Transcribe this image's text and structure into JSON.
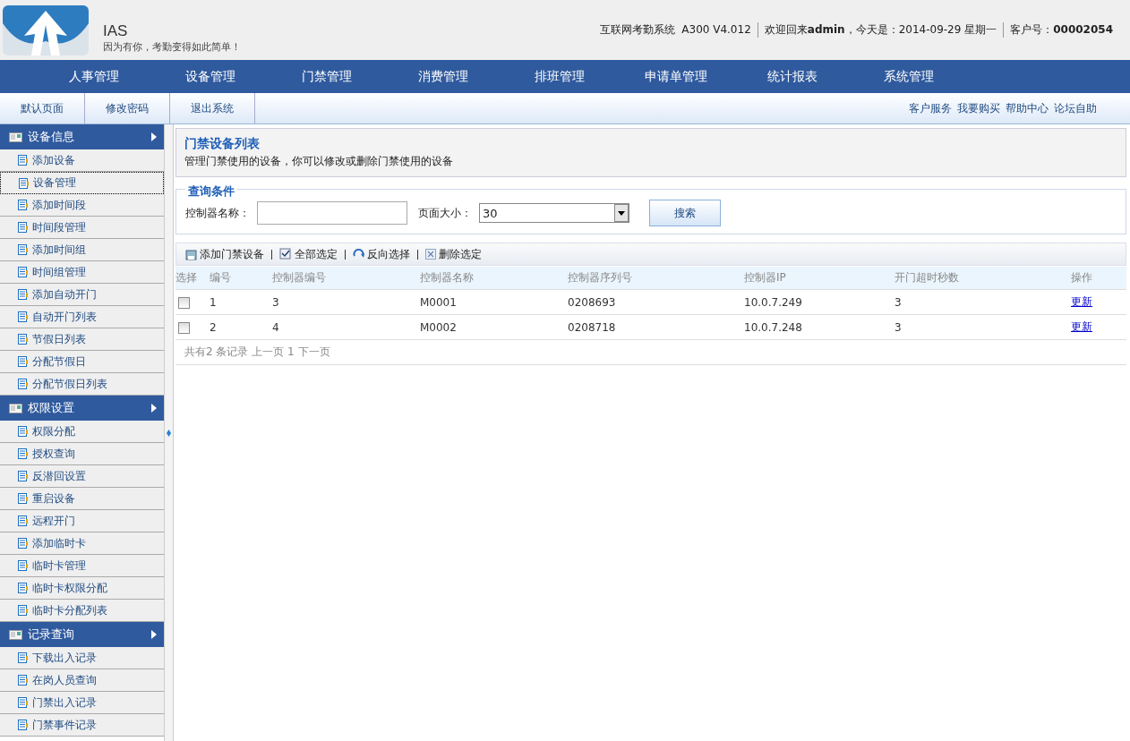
{
  "header": {
    "app_name": "IAS",
    "slogan": "因为有你，考勤变得如此简单！",
    "system": "互联网考勤系统  A300 V4.012",
    "welcome": "欢迎回来**admin**，今天是：2014-09-29 星期一",
    "customer": "客户号：**00002054**"
  },
  "main_nav": [
    "人事管理",
    "设备管理",
    "门禁管理",
    "消费管理",
    "排班管理",
    "申请单管理",
    "统计报表",
    "系统管理"
  ],
  "sub_nav": [
    "默认页面",
    "修改密码",
    "退出系统"
  ],
  "top_links": [
    "客户服务",
    "我要购买",
    "帮助中心",
    "论坛自助"
  ],
  "sidebar": [
    {
      "title": "设备信息",
      "expanded": true,
      "items": [
        {
          "label": "添加设备",
          "selected": false
        },
        {
          "label": "设备管理",
          "selected": true
        },
        {
          "label": "添加时间段",
          "selected": false
        },
        {
          "label": "时间段管理",
          "selected": false
        },
        {
          "label": "添加时间组",
          "selected": false
        },
        {
          "label": "时间组管理",
          "selected": false
        },
        {
          "label": "添加自动开门",
          "selected": false
        },
        {
          "label": "自动开门列表",
          "selected": false
        },
        {
          "label": "节假日列表",
          "selected": false
        },
        {
          "label": "分配节假日",
          "selected": false
        },
        {
          "label": "分配节假日列表",
          "selected": false
        }
      ]
    },
    {
      "title": "权限设置",
      "expanded": true,
      "items": [
        {
          "label": "权限分配",
          "selected": false
        },
        {
          "label": "授权查询",
          "selected": false
        },
        {
          "label": "反潜回设置",
          "selected": false
        },
        {
          "label": "重启设备",
          "selected": false
        },
        {
          "label": "远程开门",
          "selected": false
        },
        {
          "label": "添加临时卡",
          "selected": false
        },
        {
          "label": "临时卡管理",
          "selected": false
        },
        {
          "label": "临时卡权限分配",
          "selected": false
        },
        {
          "label": "临时卡分配列表",
          "selected": false
        }
      ]
    },
    {
      "title": "记录查询",
      "expanded": true,
      "items": [
        {
          "label": "下载出入记录",
          "selected": false
        },
        {
          "label": "在岗人员查询",
          "selected": false
        },
        {
          "label": "门禁出入记录",
          "selected": false
        },
        {
          "label": "门禁事件记录",
          "selected": false
        }
      ]
    }
  ],
  "page": {
    "title": "门禁设备列表",
    "description": "管理门禁使用的设备，你可以修改或删除门禁使用的设备"
  },
  "query": {
    "legend": "查询条件",
    "name_label": "控制器名称：",
    "page_size_label": "页面大小：",
    "page_size": "30",
    "search_button": "搜索"
  },
  "toolbar": [
    {
      "kind": "add",
      "label": "添加门禁设备"
    },
    {
      "kind": "select-all",
      "label": "全部选定"
    },
    {
      "kind": "invert",
      "label": "反向选择"
    },
    {
      "kind": "delete",
      "label": "删除选定"
    }
  ],
  "table": {
    "columns": [
      "选择",
      "编号",
      "控制器编号",
      "控制器名称",
      "控制器序列号",
      "控制器IP",
      "开门超时秒数",
      "操作"
    ],
    "rows": [
      {
        "checked": false,
        "cells": [
          "",
          "1",
          "3",
          "M0001",
          "0208693",
          "10.0.7.249",
          "3",
          "更新"
        ]
      },
      {
        "checked": false,
        "cells": [
          "",
          "2",
          "4",
          "M0002",
          "0208718",
          "10.0.7.248",
          "3",
          "更新"
        ]
      }
    ]
  },
  "pagination": "共有2 条记录 上一页 1 下一页"
}
